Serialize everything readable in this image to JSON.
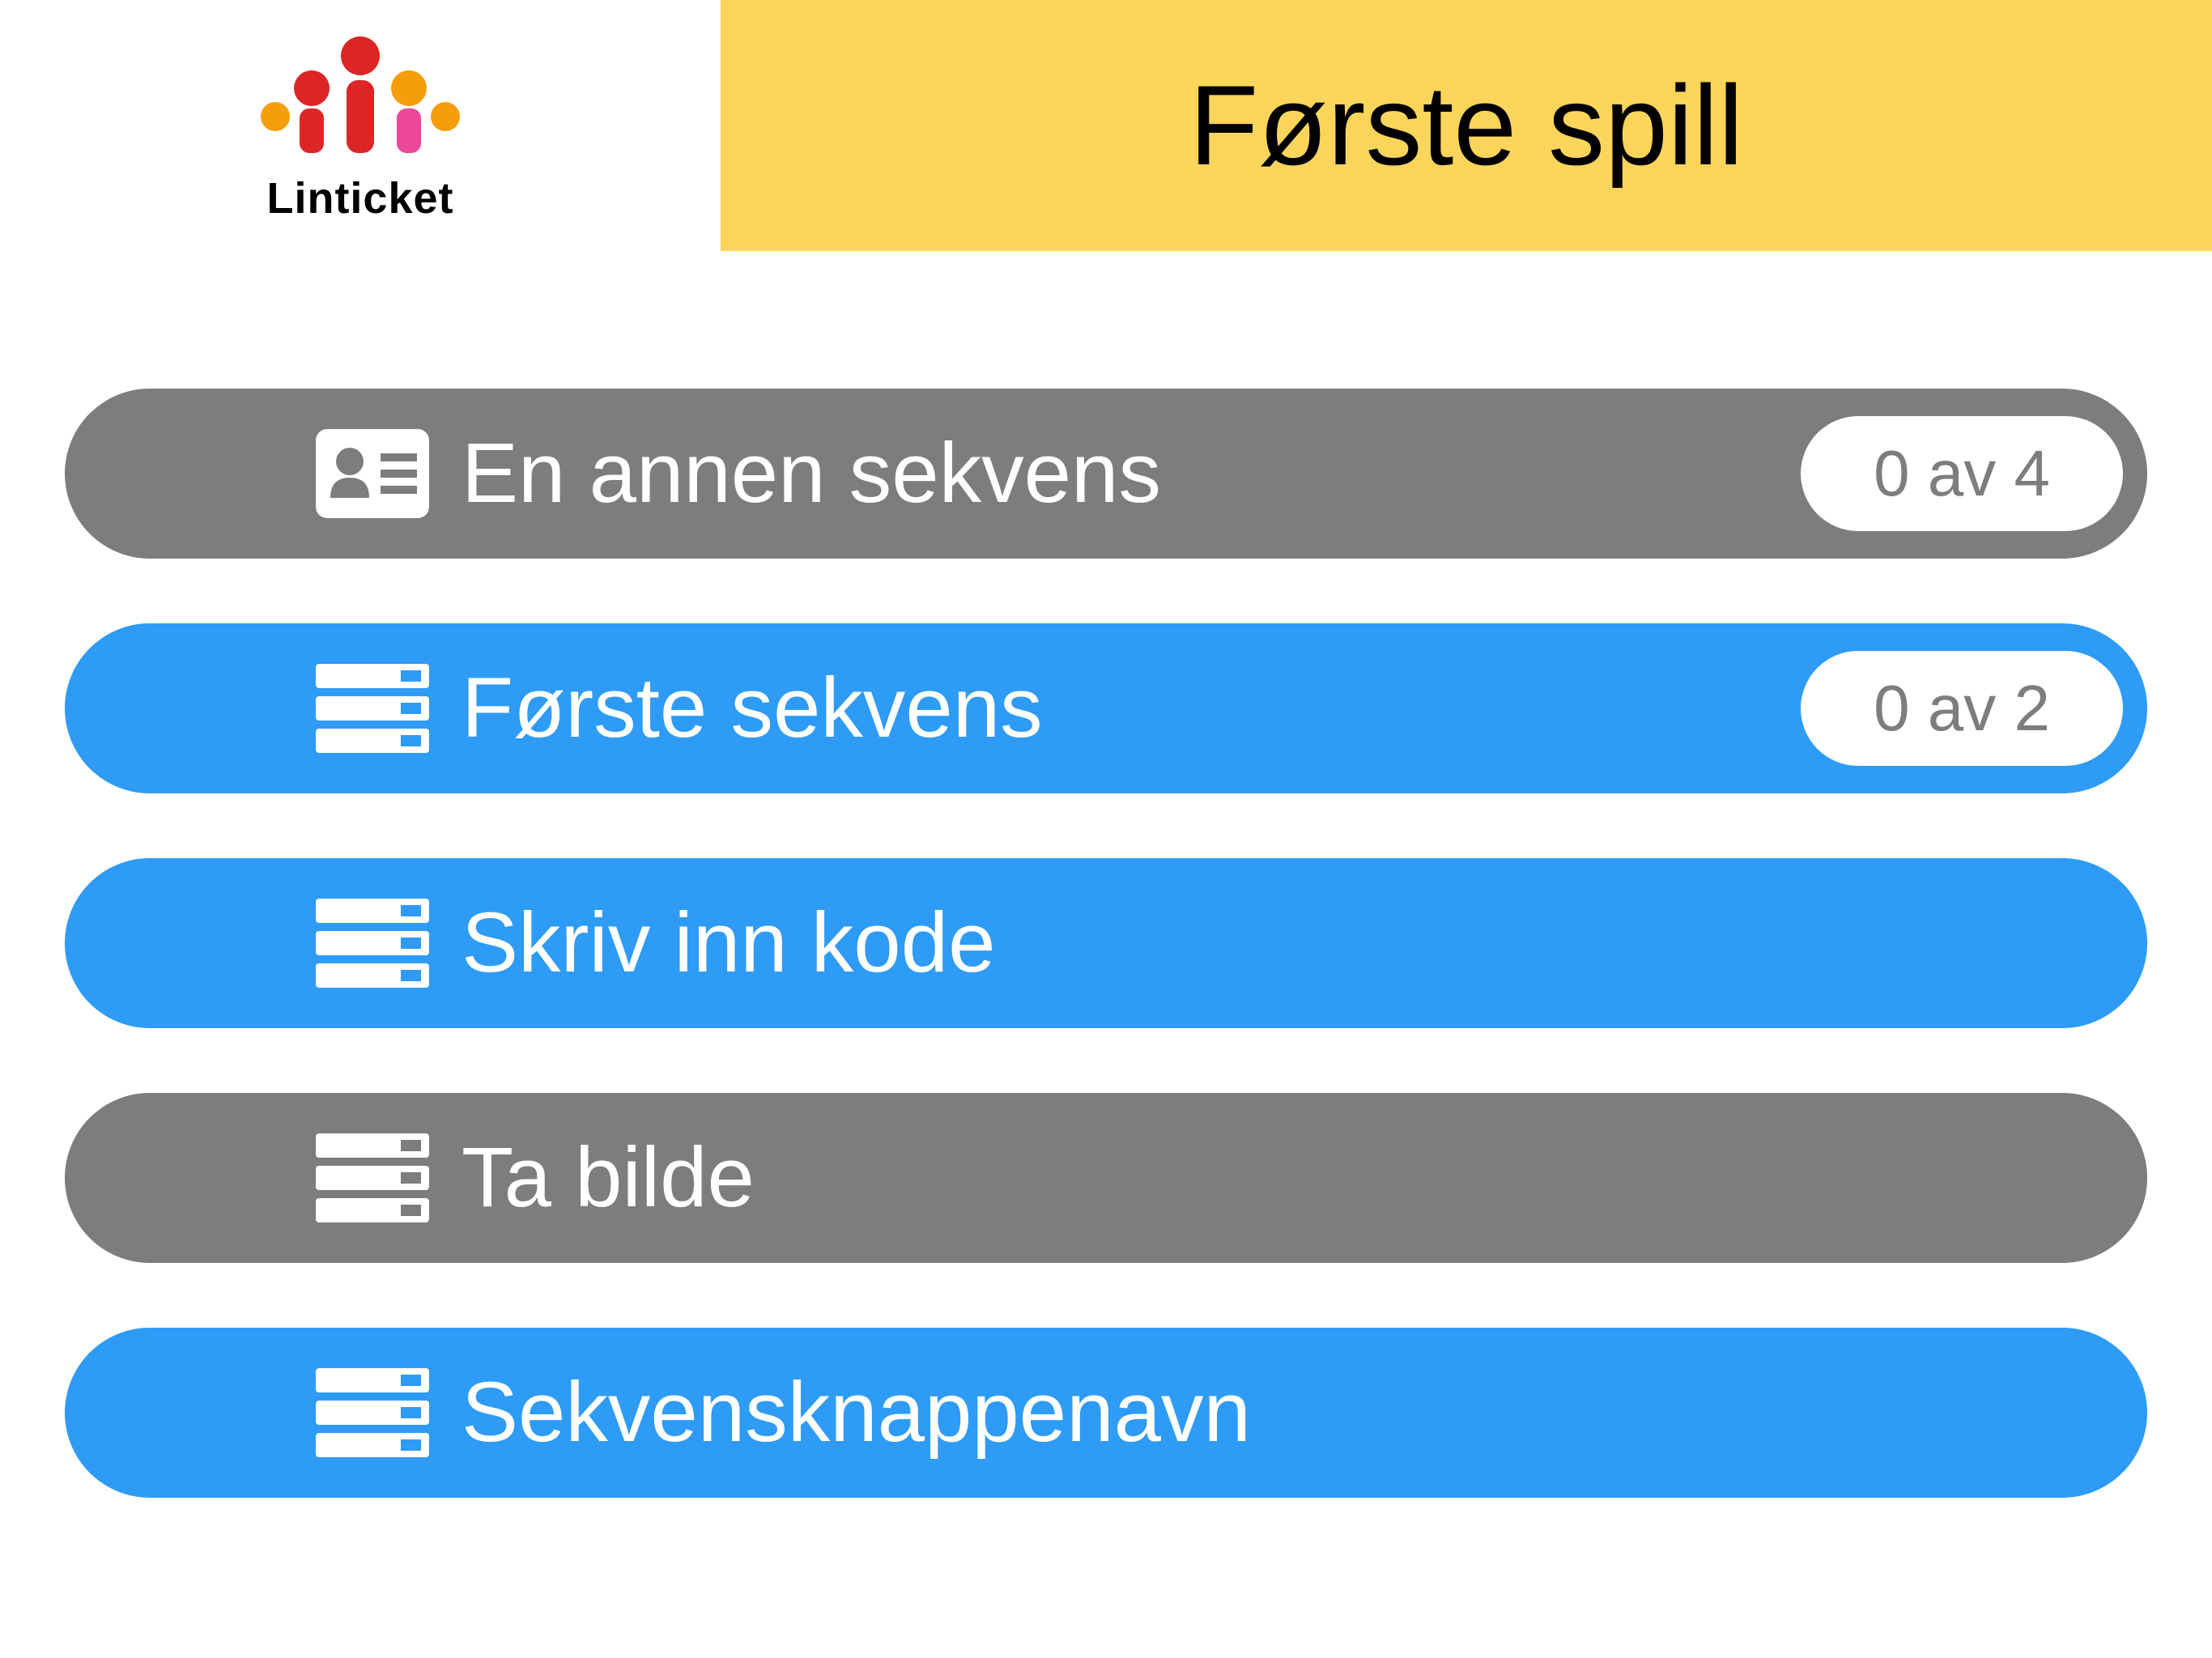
{
  "brand": {
    "name": "Linticket"
  },
  "header": {
    "title": "Første spill"
  },
  "colors": {
    "blue": "#2e9bf7",
    "gray": "#7d7d7d",
    "yellow": "#fcd55a",
    "badge_text": "#7d7d7d",
    "white": "#ffffff"
  },
  "items": [
    {
      "label": "En annen sekvens",
      "badge": "0 av 4",
      "variant": "gray",
      "icon": "id-card"
    },
    {
      "label": "Første sekvens",
      "badge": "0 av 2",
      "variant": "blue",
      "icon": "list"
    },
    {
      "label": "Skriv inn kode",
      "badge": null,
      "variant": "blue",
      "icon": "list"
    },
    {
      "label": "Ta bilde",
      "badge": null,
      "variant": "gray",
      "icon": "list"
    },
    {
      "label": "Sekvensknappenavn",
      "badge": null,
      "variant": "blue",
      "icon": "list"
    }
  ]
}
